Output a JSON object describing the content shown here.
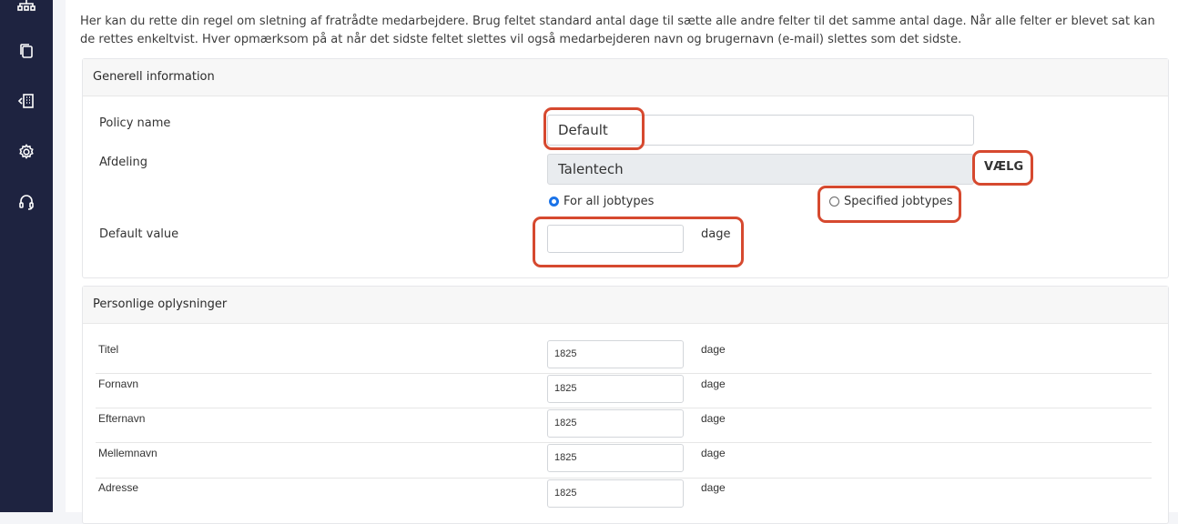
{
  "intro": "Her kan du rette din regel om sletning af fratrådte medarbejdere. Brug feltet standard antal dage til sætte alle andre felter til det samme antal dage. Når alle felter er blevet sat kan de rettes enkeltvist. Hver opmærksom på at når det sidste feltet slettes vil også medarbejderen navn og brugernavn (e-mail) slettes som det sidste.",
  "general": {
    "header": "Generell information",
    "policy_label": "Policy name",
    "policy_value": "Default",
    "department_label": "Afdeling",
    "department_value": "Talentech",
    "choose_button": "VÆLG",
    "radio_all": "For all jobtypes",
    "radio_specified": "Specified jobtypes",
    "default_value_label": "Default value",
    "default_value": "",
    "unit": "dage"
  },
  "personal": {
    "header": "Personlige oplysninger",
    "rows": [
      {
        "label": "Titel",
        "value": "1825",
        "unit": "dage"
      },
      {
        "label": "Fornavn",
        "value": "1825",
        "unit": "dage"
      },
      {
        "label": "Efternavn",
        "value": "1825",
        "unit": "dage"
      },
      {
        "label": "Mellemnavn",
        "value": "1825",
        "unit": "dage"
      },
      {
        "label": "Adresse",
        "value": "1825",
        "unit": "dage"
      }
    ]
  },
  "sidebar": {
    "icons": [
      "org-chart-icon",
      "copy-icon",
      "building-icon",
      "gear-icon",
      "headset-icon"
    ]
  },
  "colors": {
    "sidebar": "#1e2340",
    "highlight": "#d6492f",
    "radio_selected": "#1a73e8"
  }
}
